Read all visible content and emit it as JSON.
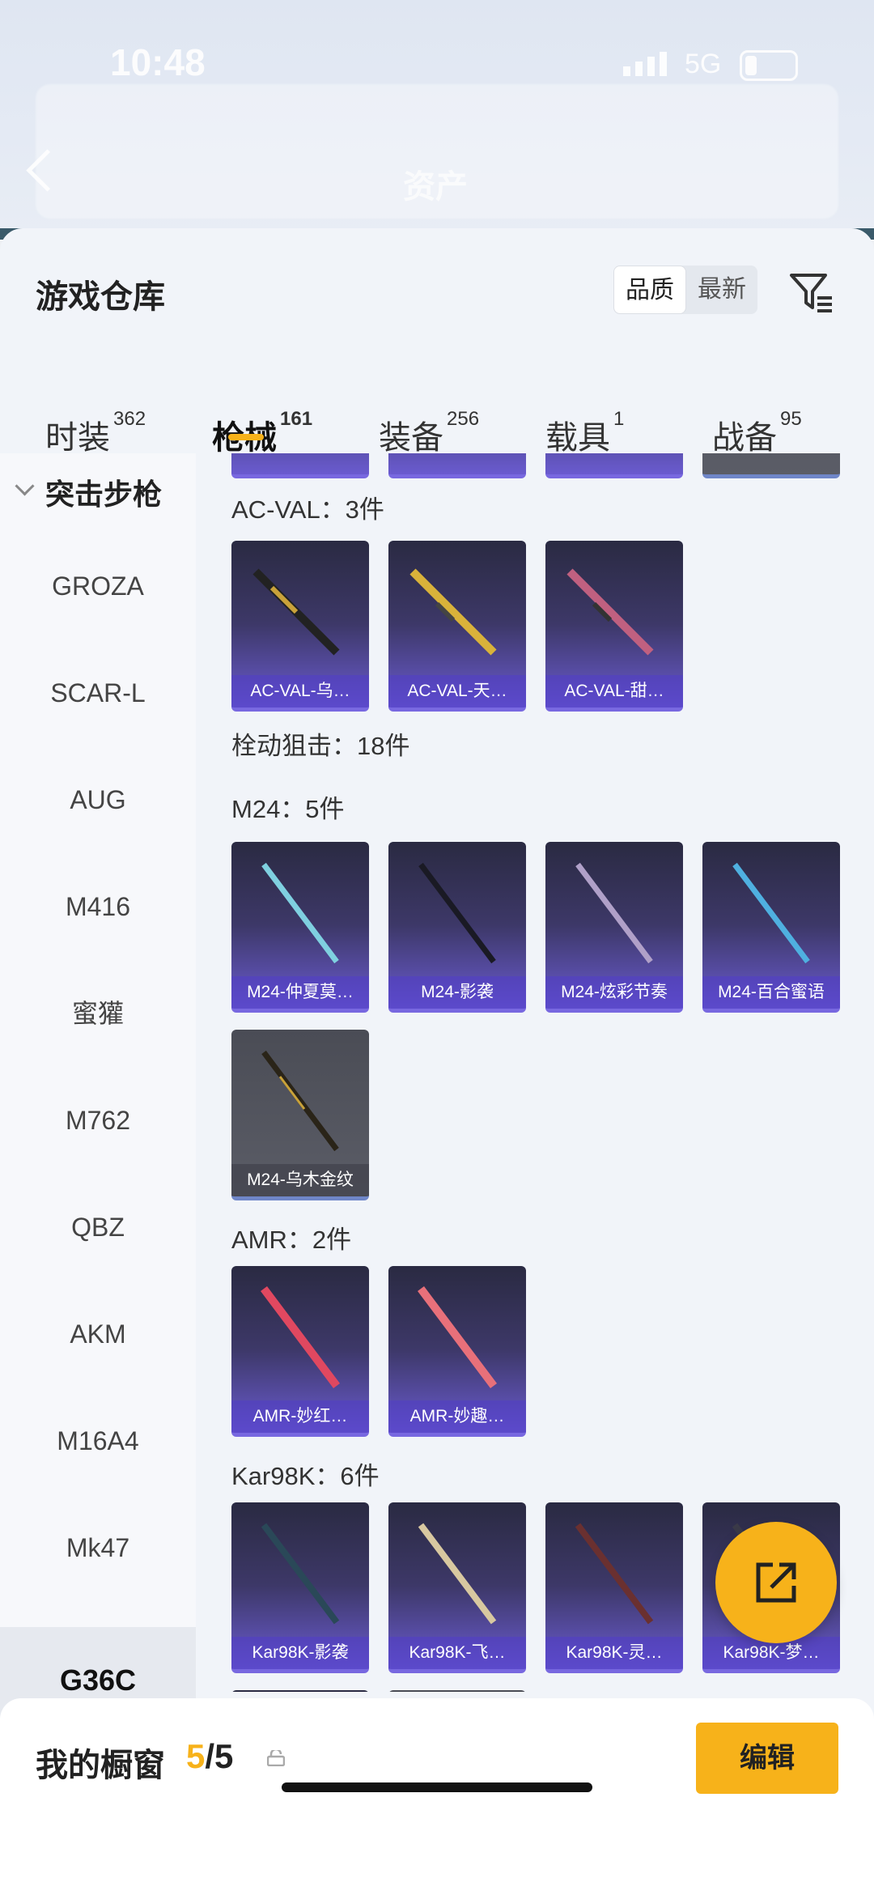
{
  "status_bar": {
    "time": "10:48",
    "network": "5G"
  },
  "background": {
    "title": "资产"
  },
  "sheet": {
    "title": "游戏仓库",
    "sort_options": [
      "品质",
      "最新"
    ],
    "active_sort": "品质",
    "filter_icon": "filter-icon"
  },
  "tabs": [
    {
      "label": "时装",
      "count": "362"
    },
    {
      "label": "枪械",
      "count": "161",
      "active": true
    },
    {
      "label": "装备",
      "count": "256"
    },
    {
      "label": "载具",
      "count": "1"
    },
    {
      "label": "战备",
      "count": "95"
    }
  ],
  "sidebar": {
    "section": "突击步枪",
    "items": [
      "GROZA",
      "SCAR-L",
      "AUG",
      "M416",
      "蜜獾",
      "M762",
      "QBZ",
      "AKM",
      "M16A4",
      "Mk47",
      "G36C"
    ],
    "active_item": "G36C"
  },
  "groups": {
    "acval": {
      "label": "AC-VAL：3件",
      "items": [
        "AC-VAL-乌…",
        "AC-VAL-天…",
        "AC-VAL-甜…"
      ]
    },
    "bolt": {
      "label": "栓动狙击：18件"
    },
    "m24": {
      "label": "M24：5件",
      "items": [
        "M24-仲夏莫…",
        "M24-影袭",
        "M24-炫彩节奏",
        "M24-百合蜜语",
        "M24-乌木金纹"
      ]
    },
    "amr": {
      "label": "AMR：2件",
      "items": [
        "AMR-妙红…",
        "AMR-妙趣…"
      ]
    },
    "kar": {
      "label": "Kar98K：6件",
      "items": [
        "Kar98K-影袭",
        "Kar98K-飞…",
        "Kar98K-灵…",
        "Kar98K-梦…"
      ]
    }
  },
  "bottom_bar": {
    "title": "我的橱窗",
    "count_current": "5",
    "count_sep_total": "/5",
    "edit_label": "编辑"
  },
  "colors": {
    "accent": "#f7b21a",
    "card_purple": "#6a5bcf",
    "card_grey": "#5b5d67"
  }
}
